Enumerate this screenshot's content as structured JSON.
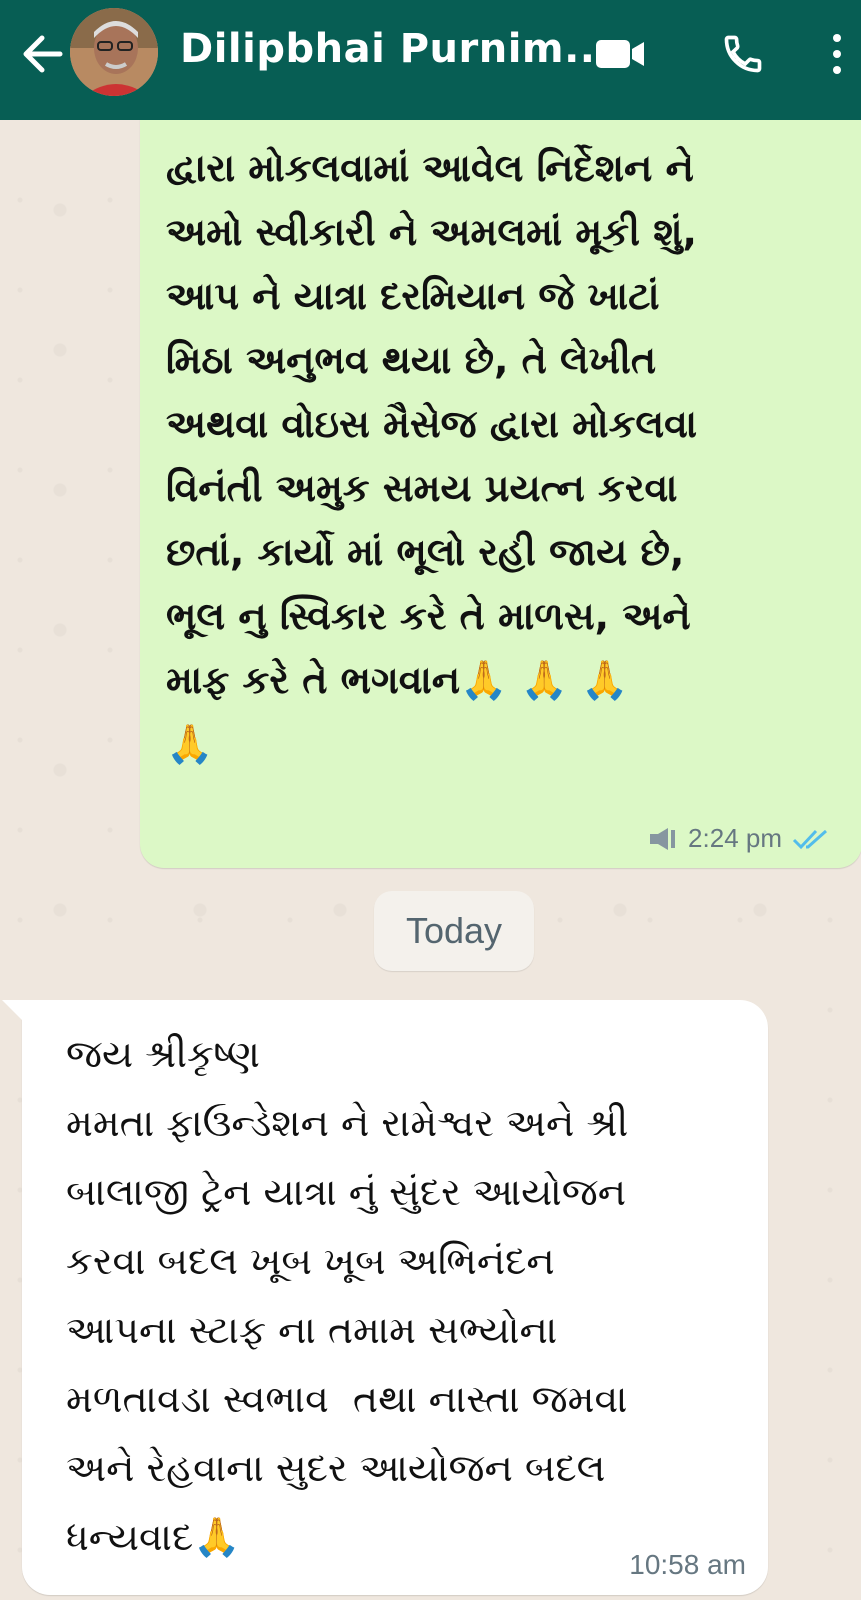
{
  "header": {
    "contact_name": "Dilipbhai Purnim..."
  },
  "icons": {
    "back": "back-arrow-icon",
    "video": "video-call-icon",
    "call": "phone-call-icon",
    "menu": "more-vert-icon",
    "tick": "double-check-icon",
    "voice": "forwarded-audio-icon"
  },
  "colors": {
    "header": "#075e54",
    "outgoing_bubble": "#dcf8c6",
    "incoming_bubble": "#ffffff",
    "tick_blue": "#53bdeb",
    "chat_bg": "#efe7de"
  },
  "messages": {
    "outgoing": {
      "text": "દ્વારા મોકલવામાં આવેલ નિર્દેશન ને\nઅમો સ્વીકારી ને અમલમાં મૂકી શું,\nઆપ ને યાત્રા દરમિયાન જે ખાટાં\nમિઠા અનુભવ થયા છે, તે લેખીત\nઅથવા વોઇસ મૈસેજ દ્વારા મોકલવા\nવિનંતી અમુક સમય પ્રયત્ન કરવા\nછતાં, કાર્યો માં ભૂલો રહી જાય છે,\nભૂલ નુ સ્વિકાર કરે તે માળસ, અને\nમાફ કરે તે ભગવાન🙏 🙏 🙏\n🙏",
      "time": "2:24 pm"
    },
    "date_divider": "Today",
    "incoming": {
      "text": "જય શ્રીકૃષ્ણ\nમમતા ફાઉન્ડેશન ને રામેશ્વર અને શ્રી\nબાલાજી ટ્રેન યાત્રા નું સુંદર આયોજન\nકરવા બદલ ખૂબ ખૂબ અભિનંદન\nઆપના સ્ટાફ ના તમામ સભ્યોના\nમળતાવડા સ્વભાવ  તથા નાસ્તા જમવા\nઅને રેહવાના સુદર આયોજન બદલ\nધન્યવાદ🙏",
      "time": "10:58 am"
    }
  }
}
